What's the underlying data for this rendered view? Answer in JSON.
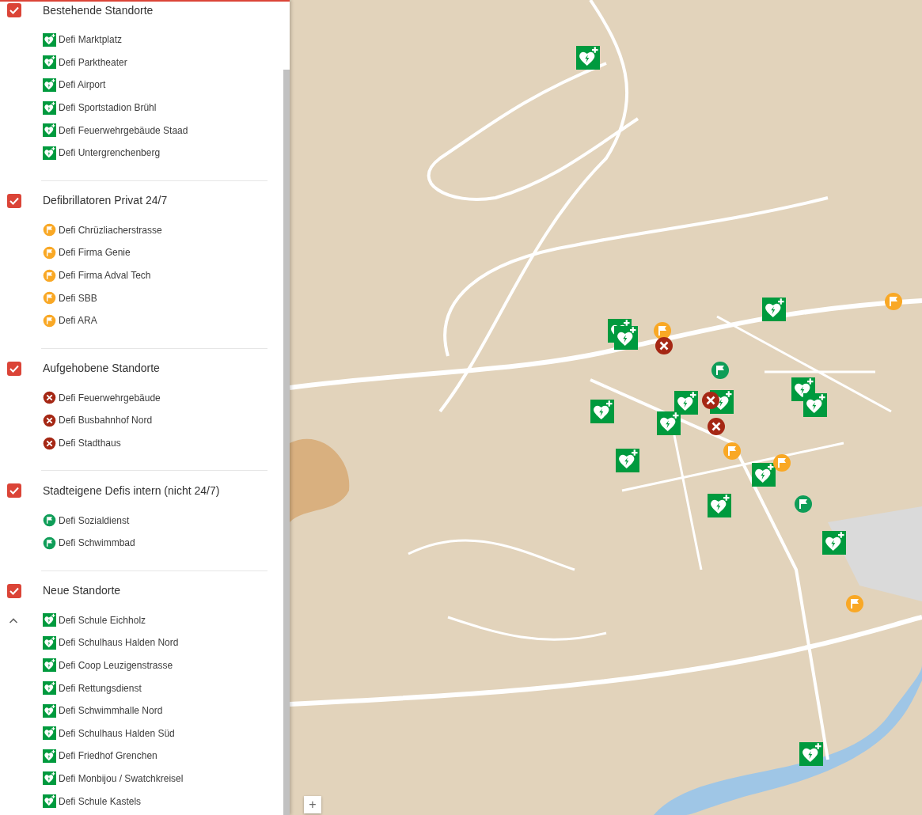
{
  "layers": [
    {
      "title": "Bestehende Standorte",
      "checked": true,
      "items": [
        {
          "kind": "aed",
          "label": "Defi Marktplatz"
        },
        {
          "kind": "aed",
          "label": "Defi Parktheater"
        },
        {
          "kind": "aed",
          "label": "Defi Airport"
        },
        {
          "kind": "aed",
          "label": "Defi Sportstadion Brühl"
        },
        {
          "kind": "aed",
          "label": "Defi Feuerwehrgebäude Staad"
        },
        {
          "kind": "aed",
          "label": "Defi Untergrenchenberg"
        }
      ]
    },
    {
      "title": "Defibrillatoren Privat 24/7",
      "checked": true,
      "items": [
        {
          "kind": "private",
          "label": "Defi Chrüzliacherstrasse"
        },
        {
          "kind": "private",
          "label": "Defi Firma Genie"
        },
        {
          "kind": "private",
          "label": "Defi Firma Adval Tech"
        },
        {
          "kind": "private",
          "label": "Defi SBB"
        },
        {
          "kind": "private",
          "label": "Defi ARA"
        }
      ]
    },
    {
      "title": "Aufgehobene Standorte",
      "checked": true,
      "items": [
        {
          "kind": "removed",
          "label": "Defi Feuerwehrgebäude"
        },
        {
          "kind": "removed",
          "label": "Defi Busbahnhof Nord"
        },
        {
          "kind": "removed",
          "label": "Defi Stadthaus"
        }
      ]
    },
    {
      "title": "Stadteigene Defis intern (nicht 24/7)",
      "checked": true,
      "items": [
        {
          "kind": "internal",
          "label": "Defi Sozialdienst"
        },
        {
          "kind": "internal",
          "label": "Defi Schwimmbad"
        }
      ]
    },
    {
      "title": "Neue Standorte",
      "checked": true,
      "collapse_toggle": {
        "expanded": true
      },
      "items": [
        {
          "kind": "aed",
          "label": "Defi Schule Eichholz"
        },
        {
          "kind": "aed",
          "label": "Defi Schulhaus Halden Nord"
        },
        {
          "kind": "aed",
          "label": "Defi Coop Leuzigenstrasse"
        },
        {
          "kind": "aed",
          "label": "Defi Rettungsdienst"
        },
        {
          "kind": "aed",
          "label": "Defi Schwimmhalle Nord"
        },
        {
          "kind": "aed",
          "label": "Defi Schulhaus Halden Süd"
        },
        {
          "kind": "aed",
          "label": "Defi Friedhof Grenchen"
        },
        {
          "kind": "aed",
          "label": "Defi Monbijou / Swatchkreisel"
        },
        {
          "kind": "aed",
          "label": "Defi Schule Kastels"
        }
      ]
    }
  ],
  "map": {
    "kind": "picture",
    "zoom_button": "+",
    "markers": [
      {
        "kind": "aed"
      },
      {
        "kind": "aed"
      },
      {
        "kind": "aed"
      },
      {
        "kind": "aed"
      },
      {
        "kind": "aed"
      },
      {
        "kind": "aed"
      },
      {
        "kind": "aed"
      },
      {
        "kind": "aed"
      },
      {
        "kind": "aed"
      },
      {
        "kind": "aed"
      },
      {
        "kind": "aed"
      },
      {
        "kind": "aed"
      },
      {
        "kind": "aed"
      },
      {
        "kind": "aed"
      },
      {
        "kind": "aed"
      },
      {
        "kind": "private"
      },
      {
        "kind": "private"
      },
      {
        "kind": "private"
      },
      {
        "kind": "private"
      },
      {
        "kind": "private"
      },
      {
        "kind": "removed"
      },
      {
        "kind": "removed"
      },
      {
        "kind": "removed"
      },
      {
        "kind": "internal"
      },
      {
        "kind": "internal"
      }
    ]
  }
}
